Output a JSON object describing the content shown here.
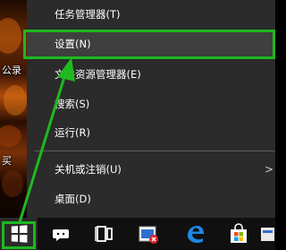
{
  "desktop": {
    "icon_labels": [
      "公录",
      "买"
    ]
  },
  "context_menu": {
    "items": [
      {
        "label": "任务管理器(T)"
      },
      {
        "label": "设置(N)"
      },
      {
        "label": "文件资源管理器(E)"
      },
      {
        "label": "搜索(S)"
      },
      {
        "label": "运行(R)"
      },
      {
        "label": "关机或注销(U)",
        "submenu": true
      },
      {
        "label": "桌面(D)"
      }
    ],
    "submenu_arrow": ">"
  },
  "taskbar": {
    "start_icon": "windows-logo-icon",
    "icons": [
      "cortana-icon",
      "task-view-icon",
      "video-app-icon",
      "edge-icon",
      "store-icon",
      "app-icon"
    ]
  },
  "colors": {
    "menu_bg": "#2b2b2b",
    "highlight_green": "#1fb81f",
    "taskbar_bg": "#101010",
    "edge_blue": "#1e88e5"
  }
}
